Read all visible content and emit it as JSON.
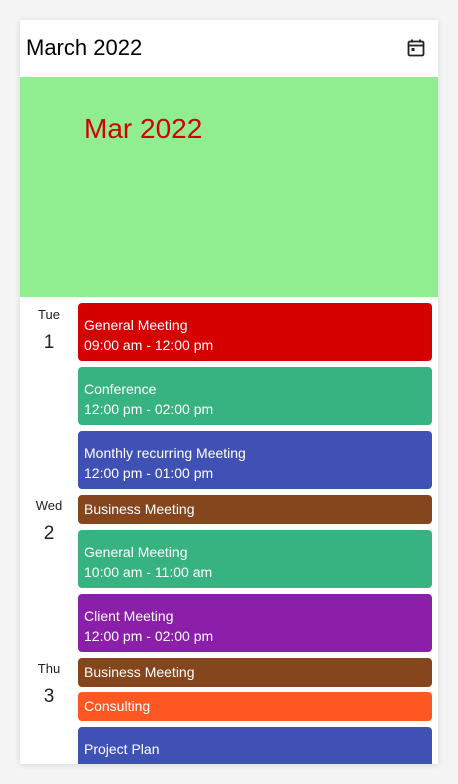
{
  "header": {
    "title": "March 2022",
    "icon": "calendar-icon"
  },
  "banner": {
    "label": "Mar 2022",
    "bg": "#90ee90",
    "color": "#d50000"
  },
  "days": [
    {
      "name": "Tue",
      "num": "1"
    },
    {
      "name": "Wed",
      "num": "2"
    },
    {
      "name": "Thu",
      "num": "3"
    }
  ],
  "events": [
    {
      "title": "General Meeting",
      "time": "09:00 am - 12:00 pm",
      "color": "#d50000"
    },
    {
      "title": "Conference",
      "time": "12:00 pm - 02:00 pm",
      "color": "#36b37e"
    },
    {
      "title": "Monthly recurring Meeting",
      "time": "12:00 pm - 01:00 pm",
      "color": "#3f51b5"
    },
    {
      "title": "Business Meeting",
      "color": "#85461e"
    },
    {
      "title": "General Meeting",
      "time": "10:00 am - 11:00 am",
      "color": "#36b37e"
    },
    {
      "title": "Client Meeting",
      "time": "12:00 pm - 02:00 pm",
      "color": "#8b1fa9"
    },
    {
      "title": "Business Meeting",
      "color": "#85461e"
    },
    {
      "title": "Consulting",
      "color": "#ff5722"
    },
    {
      "title": "Project Plan",
      "color": "#3f51b5"
    }
  ]
}
